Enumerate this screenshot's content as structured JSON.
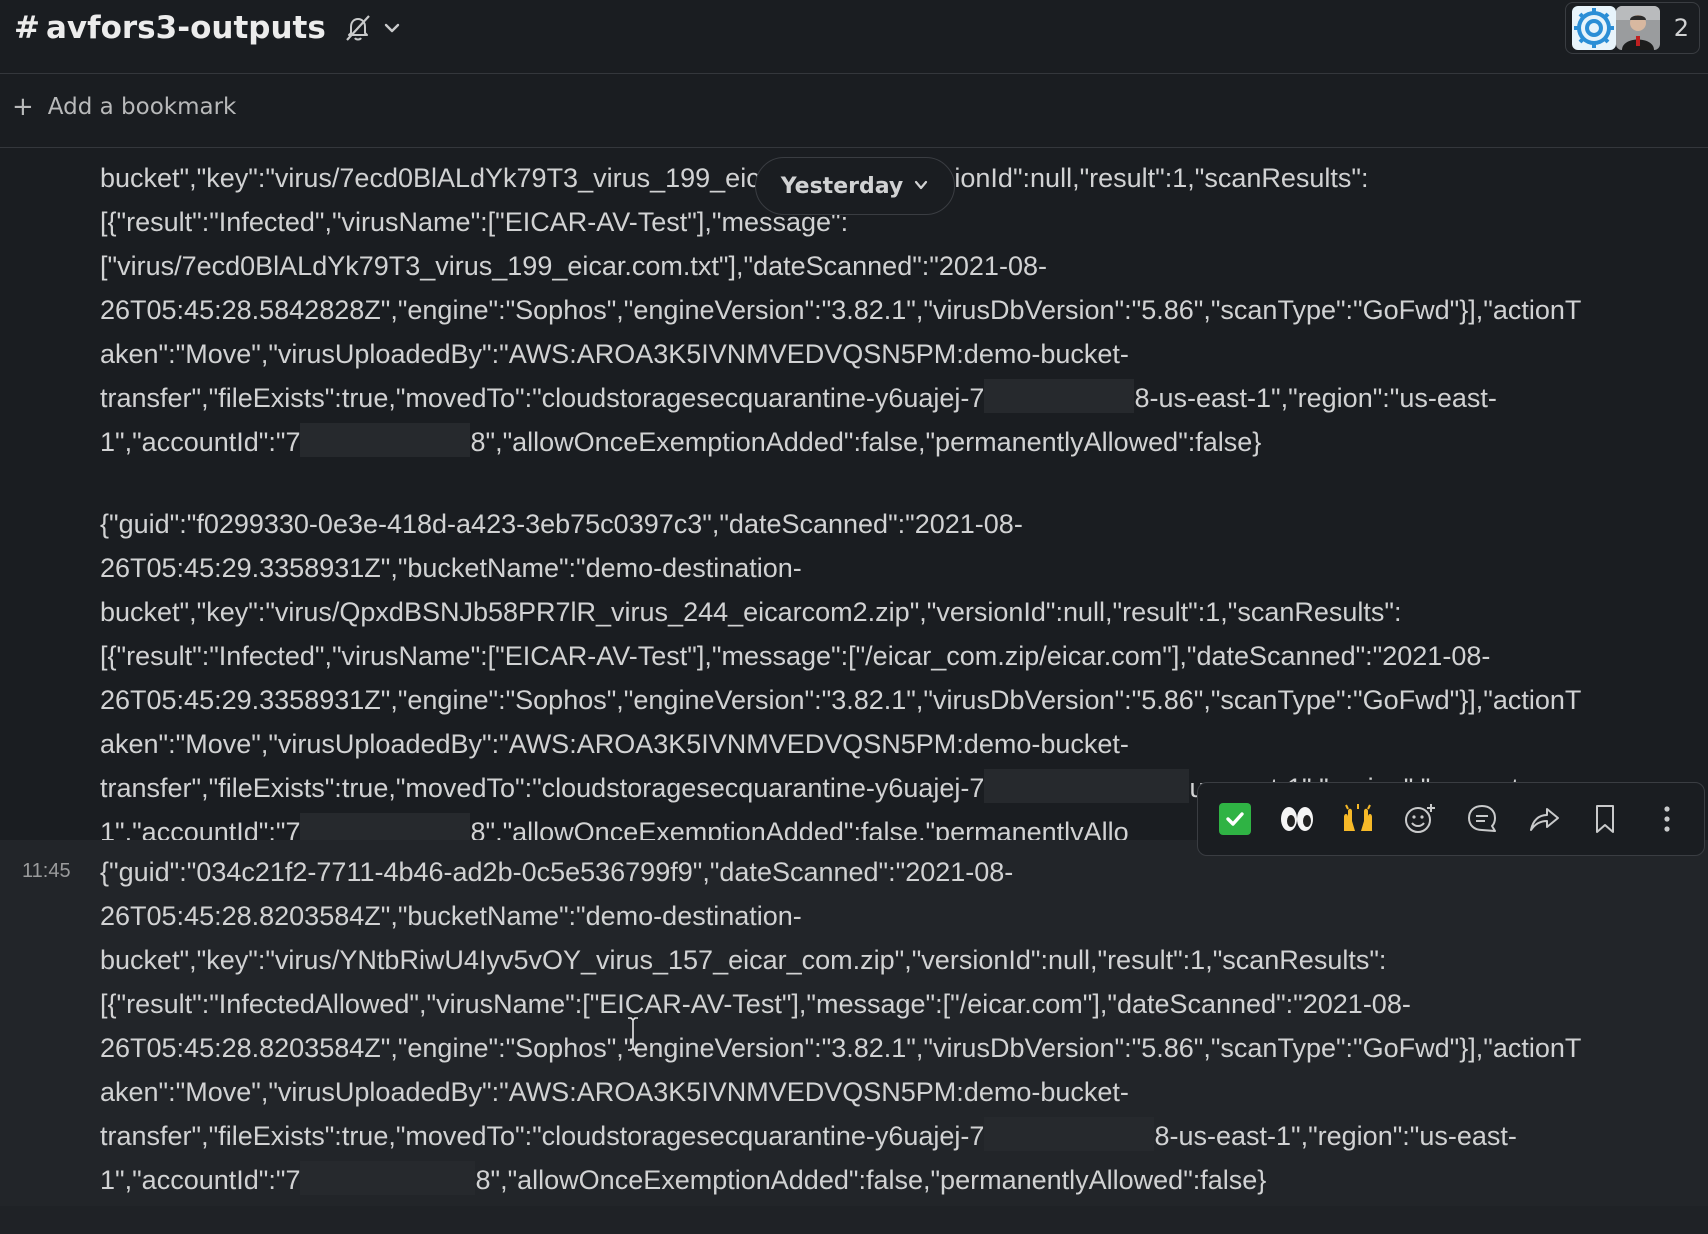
{
  "header": {
    "hash": "#",
    "channel_name": "avfors3-outputs",
    "member_count": "2"
  },
  "bookmark": {
    "plus": "+",
    "label": "Add a bookmark"
  },
  "date_pill": {
    "label": "Yesterday"
  },
  "messages": [
    {
      "time": "",
      "lines": [
        "bucket\",\"key\":\"virus/7ecd0BlALdYk79T3_virus_199_eicar.com.txt\",\"versionId\":null,\"result\":1,\"scanResults\":",
        "[{\"result\":\"Infected\",\"virusName\":[\"EICAR-AV-Test\"],\"message\":",
        "[\"virus/7ecd0BlALdYk79T3_virus_199_eicar.com.txt\"],\"dateScanned\":\"2021-08-",
        "26T05:45:28.5842828Z\",\"engine\":\"Sophos\",\"engineVersion\":\"3.82.1\",\"virusDbVersion\":\"5.86\",\"scanType\":\"GoFwd\"}],\"actionT",
        "aken\":\"Move\",\"virusUploadedBy\":\"AWS:AROA3K5IVNMVEDVQSN5PM:demo-bucket-"
      ],
      "line6_a": "transfer\",\"fileExists\":true,\"movedTo\":\"cloudstoragesecquarantine-y6uajej-7",
      "line6_b": "8-us-east-1\",\"region\":\"us-east-",
      "line7_a": "1\",\"accountId\":\"7",
      "line7_b": "8\",\"allowOnceExemptionAdded\":false,\"permanentlyAllowed\":false}"
    },
    {
      "time": "",
      "lines": [
        "{\"guid\":\"f0299330-0e3e-418d-a423-3eb75c0397c3\",\"dateScanned\":\"2021-08-",
        "26T05:45:29.3358931Z\",\"bucketName\":\"demo-destination-",
        "bucket\",\"key\":\"virus/QpxdBSNJb58PR7lR_virus_244_eicarcom2.zip\",\"versionId\":null,\"result\":1,\"scanResults\":",
        "[{\"result\":\"Infected\",\"virusName\":[\"EICAR-AV-Test\"],\"message\":[\"/eicar_com.zip/eicar.com\"],\"dateScanned\":\"2021-08-",
        "26T05:45:29.3358931Z\",\"engine\":\"Sophos\",\"engineVersion\":\"3.82.1\",\"virusDbVersion\":\"5.86\",\"scanType\":\"GoFwd\"}],\"actionT",
        "aken\":\"Move\",\"virusUploadedBy\":\"AWS:AROA3K5IVNMVEDVQSN5PM:demo-bucket-"
      ],
      "line7_a": "transfer\",\"fileExists\":true,\"movedTo\":\"cloudstoragesecquarantine-y6uajej-7",
      "line7_b": "us-east-1\",\"region\":\"us-east-",
      "line8_a": "1\",\"accountId\":\"7",
      "line8_b": "8\",\"allowOnceExemptionAdded\":false,\"permanentlyAllo"
    },
    {
      "time": "11:45",
      "lines": [
        "{\"guid\":\"034c21f2-7711-4b46-ad2b-0c5e536799f9\",\"dateScanned\":\"2021-08-",
        "26T05:45:28.8203584Z\",\"bucketName\":\"demo-destination-",
        "bucket\",\"key\":\"virus/YNtbRiwU4Iyv5vOY_virus_157_eicar_com.zip\",\"versionId\":null,\"result\":1,\"scanResults\":",
        "[{\"result\":\"InfectedAllowed\",\"virusName\":[\"EICAR-AV-Test\"],\"message\":[\"/eicar.com\"],\"dateScanned\":\"2021-08-",
        "26T05:45:28.8203584Z\",\"engine\":\"Sophos\",\"engineVersion\":\"3.82.1\",\"virusDbVersion\":\"5.86\",\"scanType\":\"GoFwd\"}],\"actionT",
        "aken\":\"Move\",\"virusUploadedBy\":\"AWS:AROA3K5IVNMVEDVQSN5PM:demo-bucket-"
      ],
      "line7_a": "transfer\",\"fileExists\":true,\"movedTo\":\"cloudstoragesecquarantine-y6uajej-7",
      "line7_b": "8-us-east-1\",\"region\":\"us-east-",
      "line8_a": "1\",\"accountId\":\"7",
      "line8_b": "8\",\"allowOnceExemptionAdded\":false,\"permanentlyAllowed\":false}"
    }
  ],
  "action_bar": {
    "icons": [
      "white-check-mark-emoji",
      "eyes-emoji",
      "raised-hands-emoji",
      "add-reaction-icon",
      "reply-in-thread-icon",
      "share-icon",
      "save-bookmark-icon",
      "more-actions-icon"
    ]
  },
  "colors": {
    "background": "#1a1d21",
    "text": "#d1d2d3",
    "hover_background": "#222529",
    "border": "#34373c",
    "check_green": "#2fb344"
  }
}
